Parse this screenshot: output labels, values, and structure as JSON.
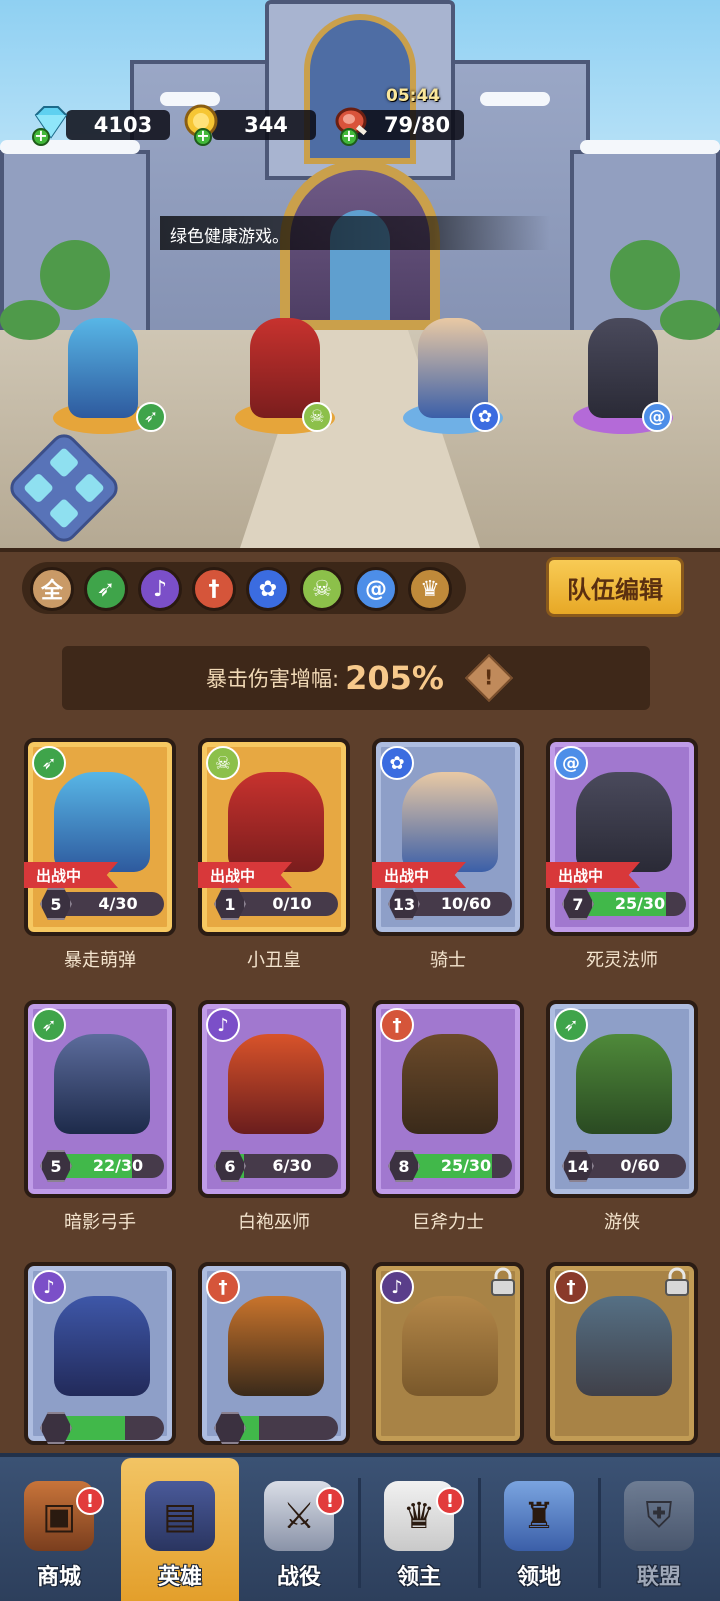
{
  "resources": {
    "gems": "4103",
    "gold": "344",
    "stamina": "79/80",
    "stamina_timer": "05:44",
    "plus": "+"
  },
  "notice": "绿色健康游戏。",
  "team_heroes": [
    {
      "class_icon": "bow-icon",
      "color": "#3fa44a"
    },
    {
      "class_icon": "skull-icon",
      "color": "#8cc04a"
    },
    {
      "class_icon": "paw-icon",
      "color": "#3b6ce0"
    },
    {
      "class_icon": "swirl-icon",
      "color": "#4d8ee8"
    }
  ],
  "filters": [
    {
      "name": "all",
      "label": "全",
      "color": "#c99a67"
    },
    {
      "name": "bow",
      "label": "",
      "color": "#3fa44a"
    },
    {
      "name": "staff",
      "label": "",
      "color": "#7b4fc8"
    },
    {
      "name": "sword",
      "label": "",
      "color": "#d5553a"
    },
    {
      "name": "paw",
      "label": "",
      "color": "#3b6ce0"
    },
    {
      "name": "skull",
      "label": "",
      "color": "#8cc04a"
    },
    {
      "name": "swirl",
      "label": "",
      "color": "#4d8ee8"
    },
    {
      "name": "crown",
      "label": "",
      "color": "#c08a3a"
    }
  ],
  "team_edit_label": "队伍编辑",
  "crit": {
    "label": "暴击伤害增幅:",
    "value": "205%",
    "info": "!"
  },
  "in_battle_label": "出战中",
  "heroes": [
    {
      "name": "暴走萌弹",
      "rarity": "orange",
      "class_icon": "bow-icon",
      "class_color": "#3fa44a",
      "level": "5",
      "progress": "4/30",
      "progress_value": 0.13,
      "in_battle": true,
      "locked": false
    },
    {
      "name": "小丑皇",
      "rarity": "orange",
      "class_icon": "skull-icon",
      "class_color": "#8cc04a",
      "level": "1",
      "progress": "0/10",
      "progress_value": 0,
      "in_battle": true,
      "locked": false
    },
    {
      "name": "骑士",
      "rarity": "blue",
      "class_icon": "paw-icon",
      "class_color": "#3b6ce0",
      "level": "13",
      "progress": "10/60",
      "progress_value": 0.17,
      "in_battle": true,
      "locked": false
    },
    {
      "name": "死灵法师",
      "rarity": "purple",
      "class_icon": "swirl-icon",
      "class_color": "#4d8ee8",
      "level": "7",
      "progress": "25/30",
      "progress_value": 0.83,
      "in_battle": true,
      "locked": false
    },
    {
      "name": "暗影弓手",
      "rarity": "purple",
      "class_icon": "bow-icon",
      "class_color": "#3fa44a",
      "level": "5",
      "progress": "22/30",
      "progress_value": 0.73,
      "in_battle": false,
      "locked": false
    },
    {
      "name": "白袍巫师",
      "rarity": "purple",
      "class_icon": "staff-icon",
      "class_color": "#7b4fc8",
      "level": "6",
      "progress": "6/30",
      "progress_value": 0.2,
      "in_battle": false,
      "locked": false
    },
    {
      "name": "巨斧力士",
      "rarity": "purple",
      "class_icon": "sword-icon",
      "class_color": "#d5553a",
      "level": "8",
      "progress": "25/30",
      "progress_value": 0.83,
      "in_battle": false,
      "locked": false
    },
    {
      "name": "游侠",
      "rarity": "blue",
      "class_icon": "bow-icon",
      "class_color": "#3fa44a",
      "level": "14",
      "progress": "0/60",
      "progress_value": 0,
      "in_battle": false,
      "locked": false
    },
    {
      "name": "",
      "rarity": "blue",
      "class_icon": "staff-icon",
      "class_color": "#7b4fc8",
      "level": "",
      "progress": "",
      "progress_value": 0.67,
      "in_battle": false,
      "locked": false
    },
    {
      "name": "",
      "rarity": "blue",
      "class_icon": "sword-icon",
      "class_color": "#d5553a",
      "level": "",
      "progress": "",
      "progress_value": 0.33,
      "in_battle": false,
      "locked": false
    },
    {
      "name": "",
      "rarity": "locked",
      "class_icon": "staff-icon",
      "class_color": "#5a3e8a",
      "level": "",
      "progress": "",
      "progress_value": 0,
      "in_battle": false,
      "locked": true
    },
    {
      "name": "",
      "rarity": "locked",
      "class_icon": "sword-icon",
      "class_color": "#8a3a2a",
      "level": "",
      "progress": "",
      "progress_value": 0,
      "in_battle": false,
      "locked": true
    }
  ],
  "tabs": [
    {
      "name": "shop",
      "label": "商城",
      "icon": "chest-icon",
      "alert": true,
      "active": false,
      "dim": false
    },
    {
      "name": "heroes",
      "label": "英雄",
      "icon": "cards-icon",
      "alert": false,
      "active": true,
      "dim": false
    },
    {
      "name": "battle",
      "label": "战役",
      "icon": "swords-icon",
      "alert": true,
      "active": false,
      "dim": false
    },
    {
      "name": "lord",
      "label": "领主",
      "icon": "crown-icon",
      "alert": true,
      "active": false,
      "dim": false
    },
    {
      "name": "territory",
      "label": "领地",
      "icon": "castle-icon",
      "alert": false,
      "active": false,
      "dim": false
    },
    {
      "name": "alliance",
      "label": "联盟",
      "icon": "shield-icon",
      "alert": false,
      "active": false,
      "dim": true
    }
  ],
  "alert_glyph": "!"
}
